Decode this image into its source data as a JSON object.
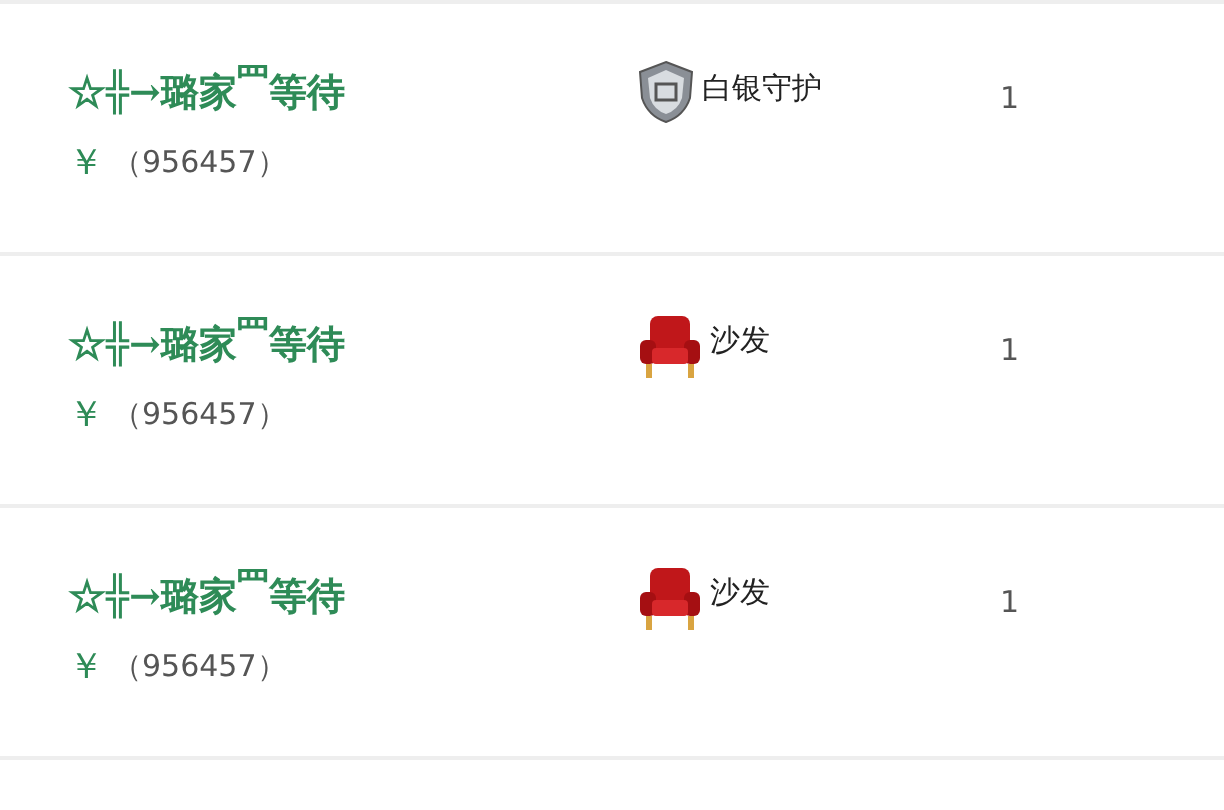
{
  "rows": [
    {
      "name": "☆╬→璐家$^{罒}$等待",
      "yen": "￥",
      "amount": "（956457）",
      "gift": {
        "kind": "shield",
        "label": "白银守护"
      },
      "count": "1"
    },
    {
      "name": "☆╬→璐家$^{罒}$等待",
      "yen": "￥",
      "amount": "（956457）",
      "gift": {
        "kind": "sofa",
        "label": "沙发"
      },
      "count": "1"
    },
    {
      "name": "☆╬→璐家$^{罒}$等待",
      "yen": "￥",
      "amount": "（956457）",
      "gift": {
        "kind": "sofa",
        "label": "沙发"
      },
      "count": "1"
    }
  ]
}
